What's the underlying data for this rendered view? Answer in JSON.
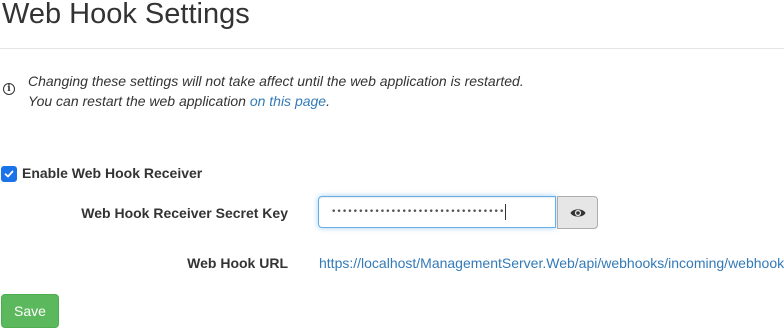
{
  "page": {
    "title": "Web Hook Settings"
  },
  "notice": {
    "icon": "info-icon",
    "line1": "Changing these settings will not take affect until the web application is restarted.",
    "line2_prefix": "You can restart the web application ",
    "line2_link": "on this page",
    "line2_suffix": "."
  },
  "receiver": {
    "enable_label": "Enable Web Hook Receiver",
    "enabled": true,
    "secret_key_label": "Web Hook Receiver Secret Key",
    "secret_key_masked": "••••••••••••••••••••••••••••••••",
    "reveal_icon": "eye-icon",
    "url_label": "Web Hook URL",
    "url_value": "https://localhost/ManagementServer.Web/api/webhooks/incoming/webhook"
  },
  "actions": {
    "save_label": "Save"
  },
  "colors": {
    "link": "#337ab7",
    "save_button": "#5cb85c",
    "checkbox": "#1a73e8",
    "input_focus_border": "#66afe9"
  }
}
